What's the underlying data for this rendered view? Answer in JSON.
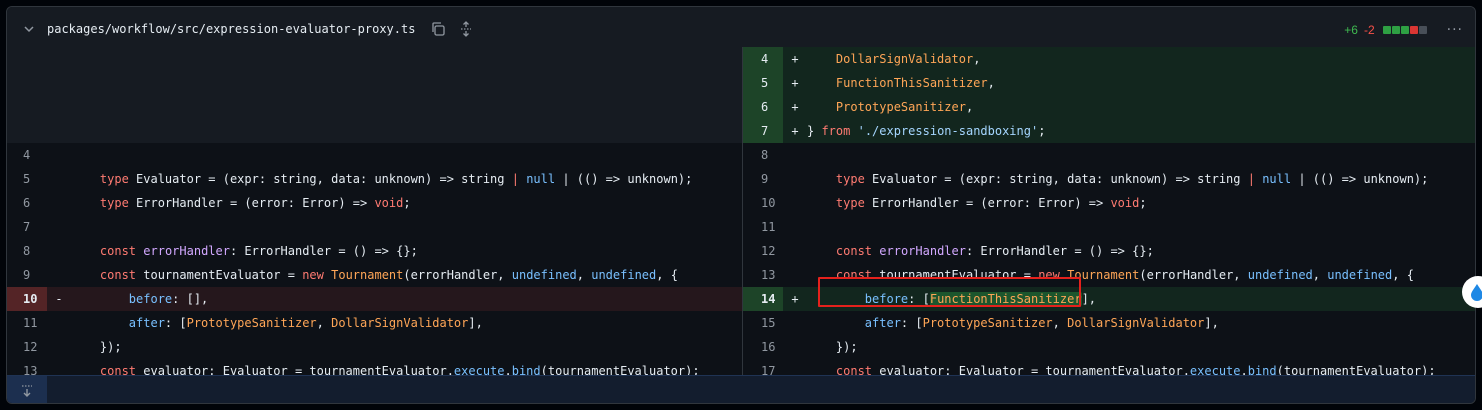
{
  "file": {
    "path": "packages/workflow/src/expression-evaluator-proxy.ts",
    "additions": "+6",
    "deletions": "-2",
    "diffstat_blocks": [
      "#2ea043",
      "#2ea043",
      "#2ea043",
      "#da3633",
      "#484f58"
    ],
    "more_label": "···"
  },
  "colors": {
    "add": "#3fb950",
    "del": "#f85149",
    "accent_box": "#e5211c"
  },
  "left_rows": [
    {
      "type": "empty"
    },
    {
      "type": "empty"
    },
    {
      "type": "empty"
    },
    {
      "type": "empty"
    },
    {
      "type": "ctx",
      "num": "4",
      "tokens": []
    },
    {
      "type": "ctx",
      "num": "5",
      "tokens": [
        [
          "    ",
          ""
        ],
        [
          "type",
          "kw"
        ],
        [
          " Evaluator = (expr: string, data: unknown) => string ",
          ""
        ],
        [
          "|",
          "kw"
        ],
        [
          " ",
          ""
        ],
        [
          "null",
          "const"
        ],
        [
          " | (() => unknown);",
          ""
        ]
      ]
    },
    {
      "type": "ctx",
      "num": "6",
      "tokens": [
        [
          "    ",
          ""
        ],
        [
          "type",
          "kw"
        ],
        [
          " ErrorHandler = (error: Error) => ",
          ""
        ],
        [
          "void",
          "kw"
        ],
        [
          ";",
          ""
        ]
      ]
    },
    {
      "type": "ctx",
      "num": "7",
      "tokens": []
    },
    {
      "type": "ctx",
      "num": "8",
      "tokens": [
        [
          "    ",
          ""
        ],
        [
          "const",
          "kw"
        ],
        [
          " ",
          ""
        ],
        [
          "errorHandler",
          "fn"
        ],
        [
          ": ErrorHandler = () => {};",
          ""
        ]
      ]
    },
    {
      "type": "ctx",
      "num": "9",
      "tokens": [
        [
          "    ",
          ""
        ],
        [
          "const",
          "kw"
        ],
        [
          " tournamentEvaluator = ",
          ""
        ],
        [
          "new",
          "kw"
        ],
        [
          " ",
          ""
        ],
        [
          "Tournament",
          "ent"
        ],
        [
          "(errorHandler, ",
          ""
        ],
        [
          "undefined",
          "const"
        ],
        [
          ", ",
          ""
        ],
        [
          "undefined",
          "const"
        ],
        [
          ", {",
          ""
        ]
      ]
    },
    {
      "type": "del",
      "num": "10",
      "mark": "-",
      "tokens": [
        [
          "        ",
          ""
        ],
        [
          "before",
          "const"
        ],
        [
          ": [],",
          ""
        ]
      ]
    },
    {
      "type": "ctx",
      "num": "11",
      "tokens": [
        [
          "        ",
          ""
        ],
        [
          "after",
          "const"
        ],
        [
          ": [",
          ""
        ],
        [
          "PrototypeSanitizer",
          "ent"
        ],
        [
          ", ",
          ""
        ],
        [
          "DollarSignValidator",
          "ent"
        ],
        [
          "],",
          ""
        ]
      ]
    },
    {
      "type": "ctx",
      "num": "12",
      "tokens": [
        [
          "    });",
          ""
        ]
      ]
    },
    {
      "type": "ctx",
      "num": "13",
      "tokens": [
        [
          "    ",
          ""
        ],
        [
          "const",
          "kw"
        ],
        [
          " evaluator: Evaluator = tournamentEvaluator.",
          ""
        ],
        [
          "execute",
          "const"
        ],
        [
          ".",
          ""
        ],
        [
          "bind",
          "const"
        ],
        [
          "(tournamentEvaluator);",
          ""
        ]
      ]
    }
  ],
  "right_rows": [
    {
      "type": "add",
      "num": "4",
      "mark": "+",
      "tokens": [
        [
          "    ",
          ""
        ],
        [
          "DollarSignValidator",
          "ent"
        ],
        [
          ",",
          ""
        ]
      ]
    },
    {
      "type": "add",
      "num": "5",
      "mark": "+",
      "tokens": [
        [
          "    ",
          ""
        ],
        [
          "FunctionThisSanitizer",
          "ent"
        ],
        [
          ",",
          ""
        ]
      ]
    },
    {
      "type": "add",
      "num": "6",
      "mark": "+",
      "tokens": [
        [
          "    ",
          ""
        ],
        [
          "PrototypeSanitizer",
          "ent"
        ],
        [
          ",",
          ""
        ]
      ]
    },
    {
      "type": "add",
      "num": "7",
      "mark": "+",
      "tokens": [
        [
          "} ",
          ""
        ],
        [
          "from",
          "kw"
        ],
        [
          " ",
          ""
        ],
        [
          "'./expression-sandboxing'",
          "str"
        ],
        [
          ";",
          ""
        ]
      ]
    },
    {
      "type": "ctx",
      "num": "8",
      "tokens": []
    },
    {
      "type": "ctx",
      "num": "9",
      "tokens": [
        [
          "    ",
          ""
        ],
        [
          "type",
          "kw"
        ],
        [
          " Evaluator = (expr: string, data: unknown) => string ",
          ""
        ],
        [
          "|",
          "kw"
        ],
        [
          " ",
          ""
        ],
        [
          "null",
          "const"
        ],
        [
          " | (() => unknown);",
          ""
        ]
      ]
    },
    {
      "type": "ctx",
      "num": "10",
      "tokens": [
        [
          "    ",
          ""
        ],
        [
          "type",
          "kw"
        ],
        [
          " ErrorHandler = (error: Error) => ",
          ""
        ],
        [
          "void",
          "kw"
        ],
        [
          ";",
          ""
        ]
      ]
    },
    {
      "type": "ctx",
      "num": "11",
      "tokens": []
    },
    {
      "type": "ctx",
      "num": "12",
      "tokens": [
        [
          "    ",
          ""
        ],
        [
          "const",
          "kw"
        ],
        [
          " ",
          ""
        ],
        [
          "errorHandler",
          "fn"
        ],
        [
          ": ErrorHandler = () => {};",
          ""
        ]
      ]
    },
    {
      "type": "ctx",
      "num": "13",
      "tokens": [
        [
          "    ",
          ""
        ],
        [
          "const",
          "kw"
        ],
        [
          " tournamentEvaluator = ",
          ""
        ],
        [
          "new",
          "kw"
        ],
        [
          " ",
          ""
        ],
        [
          "Tournament",
          "ent"
        ],
        [
          "(errorHandler, ",
          ""
        ],
        [
          "undefined",
          "const"
        ],
        [
          ", ",
          ""
        ],
        [
          "undefined",
          "const"
        ],
        [
          ", {",
          ""
        ]
      ]
    },
    {
      "type": "add",
      "num": "14",
      "mark": "+",
      "tokens": [
        [
          "        ",
          ""
        ],
        [
          "before",
          "const"
        ],
        [
          ": [",
          ""
        ],
        [
          "FunctionThisSanitizer",
          "hl"
        ],
        [
          "],",
          ""
        ]
      ]
    },
    {
      "type": "ctx",
      "num": "15",
      "tokens": [
        [
          "        ",
          ""
        ],
        [
          "after",
          "const"
        ],
        [
          ": [",
          ""
        ],
        [
          "PrototypeSanitizer",
          "ent"
        ],
        [
          ", ",
          ""
        ],
        [
          "DollarSignValidator",
          "ent"
        ],
        [
          "],",
          ""
        ]
      ]
    },
    {
      "type": "ctx",
      "num": "16",
      "tokens": [
        [
          "    });",
          ""
        ]
      ]
    },
    {
      "type": "ctx",
      "num": "17",
      "tokens": [
        [
          "    ",
          ""
        ],
        [
          "const",
          "kw"
        ],
        [
          " evaluator: Evaluator = tournamentEvaluator.",
          ""
        ],
        [
          "execute",
          "const"
        ],
        [
          ".",
          ""
        ],
        [
          "bind",
          "const"
        ],
        [
          "(tournamentEvaluator);",
          ""
        ]
      ]
    }
  ]
}
